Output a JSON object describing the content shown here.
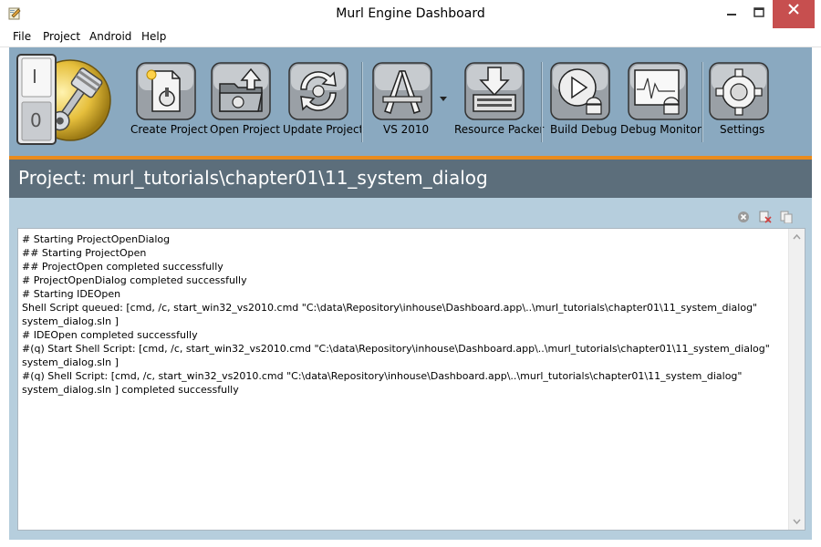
{
  "window": {
    "title": "Murl Engine Dashboard"
  },
  "menu": [
    "File",
    "Project",
    "Android",
    "Help"
  ],
  "toolbar": {
    "power_on": "I",
    "power_off": "0",
    "buttons": {
      "create_project": "Create Project",
      "open_project": "Open Project",
      "update_project": "Update Project",
      "vs2010": "VS 2010",
      "resource_packer": "Resource Packer",
      "build_debug": "Build Debug",
      "debug_monitor": "Debug Monitor",
      "settings": "Settings"
    }
  },
  "project": {
    "title": "Project: murl_tutorials\\chapter01\\11_system_dialog"
  },
  "log": {
    "lines": [
      "# Starting ProjectOpenDialog",
      "## Starting ProjectOpen",
      "## ProjectOpen completed successfully",
      "# ProjectOpenDialog completed successfully",
      "# Starting IDEOpen",
      "Shell Script queued: [cmd, /c, start_win32_vs2010.cmd \"C:\\data\\Repository\\inhouse\\Dashboard.app\\..\\murl_tutorials\\chapter01\\11_system_dialog\"",
      "system_dialog.sln ]",
      "# IDEOpen completed successfully",
      "#(q) Start Shell Script: [cmd, /c, start_win32_vs2010.cmd \"C:\\data\\Repository\\inhouse\\Dashboard.app\\..\\murl_tutorials\\chapter01\\11_system_dialog\"",
      "system_dialog.sln ]",
      "#(q) Shell Script: [cmd, /c, start_win32_vs2010.cmd \"C:\\data\\Repository\\inhouse\\Dashboard.app\\..\\murl_tutorials\\chapter01\\11_system_dialog\"",
      "system_dialog.sln ] completed successfully"
    ]
  },
  "colors": {
    "toolbar_bg": "#8aa9c0",
    "accent_orange": "#e98b1d",
    "project_bar": "#5c6e7b",
    "content_bg": "#b6cedd",
    "close_button": "#c74f4f"
  }
}
